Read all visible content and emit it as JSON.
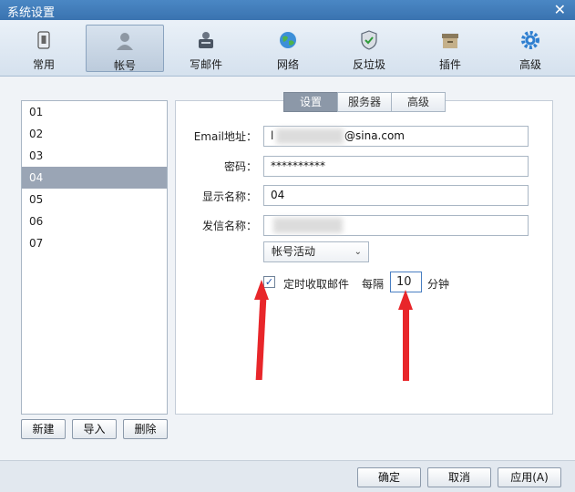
{
  "window": {
    "title": "系统设置",
    "close_glyph": "✕"
  },
  "toolbar": {
    "items": [
      {
        "label": "常用",
        "icon": "switch-icon"
      },
      {
        "label": "帐号",
        "icon": "user-icon"
      },
      {
        "label": "写邮件",
        "icon": "compose-icon"
      },
      {
        "label": "网络",
        "icon": "globe-icon"
      },
      {
        "label": "反垃圾",
        "icon": "shield-icon"
      },
      {
        "label": "插件",
        "icon": "box-icon"
      },
      {
        "label": "高级",
        "icon": "gear-icon"
      }
    ],
    "active": "帐号"
  },
  "accounts": {
    "items": [
      "01",
      "02",
      "03",
      "04",
      "05",
      "06",
      "07"
    ],
    "selected": "04",
    "new_label": "新建",
    "import_label": "导入",
    "delete_label": "删除"
  },
  "tabs": {
    "items": [
      "设置",
      "服务器",
      "高级"
    ],
    "active": "设置"
  },
  "form": {
    "email_label": "Email地址：",
    "email_prefix": "l",
    "email_suffix": "@sina.com",
    "password_label": "密码：",
    "password_value": "**********",
    "display_name_label": "显示名称：",
    "display_name_value": "04",
    "sender_name_label": "发信名称：",
    "status_select": "帐号活动",
    "timed_fetch_label": "定时收取邮件",
    "timed_fetch_checked": true,
    "interval_prefix": "每隔",
    "interval_value": "10",
    "interval_unit": "分钟"
  },
  "footer": {
    "ok_label": "确定",
    "cancel_label": "取消",
    "apply_label": "应用(A)"
  },
  "colors": {
    "annotation_arrow": "#e8262a",
    "selected_row": "#9aa5b5",
    "titlebar": "#3a73b0"
  }
}
